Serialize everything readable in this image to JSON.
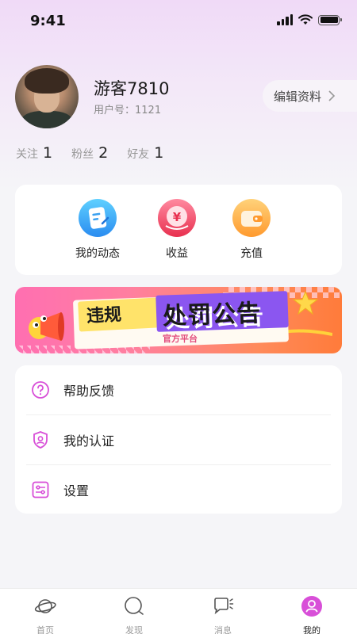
{
  "status_bar": {
    "time": "9:41"
  },
  "profile": {
    "username": "游客7810",
    "user_id": "用户号：1121",
    "edit_label": "编辑资料"
  },
  "stats": [
    {
      "label": "关注",
      "value": "1"
    },
    {
      "label": "粉丝",
      "value": "2"
    },
    {
      "label": "好友",
      "value": "1"
    }
  ],
  "features": [
    {
      "label": "我的动态",
      "icon": "note-icon",
      "color": "#3aa8f0"
    },
    {
      "label": "收益",
      "icon": "yuan-icon",
      "color": "#f0506a"
    },
    {
      "label": "充值",
      "icon": "wallet-icon",
      "color": "#ffa53a"
    }
  ],
  "banner": {
    "tag_left": "违规",
    "title": "处罚公告",
    "subtitle": "官方平台"
  },
  "menu": [
    {
      "label": "帮助反馈",
      "icon": "help-icon"
    },
    {
      "label": "我的认证",
      "icon": "shield-user-icon"
    },
    {
      "label": "设置",
      "icon": "settings-icon"
    }
  ],
  "tabs": [
    {
      "label": "首页",
      "icon": "planet-icon",
      "active": false
    },
    {
      "label": "发现",
      "icon": "discover-icon",
      "active": false
    },
    {
      "label": "消息",
      "icon": "message-icon",
      "active": false
    },
    {
      "label": "我的",
      "icon": "profile-icon",
      "active": true
    }
  ],
  "colors": {
    "accent": "#d84fd8",
    "background": "#f5f5f8"
  }
}
